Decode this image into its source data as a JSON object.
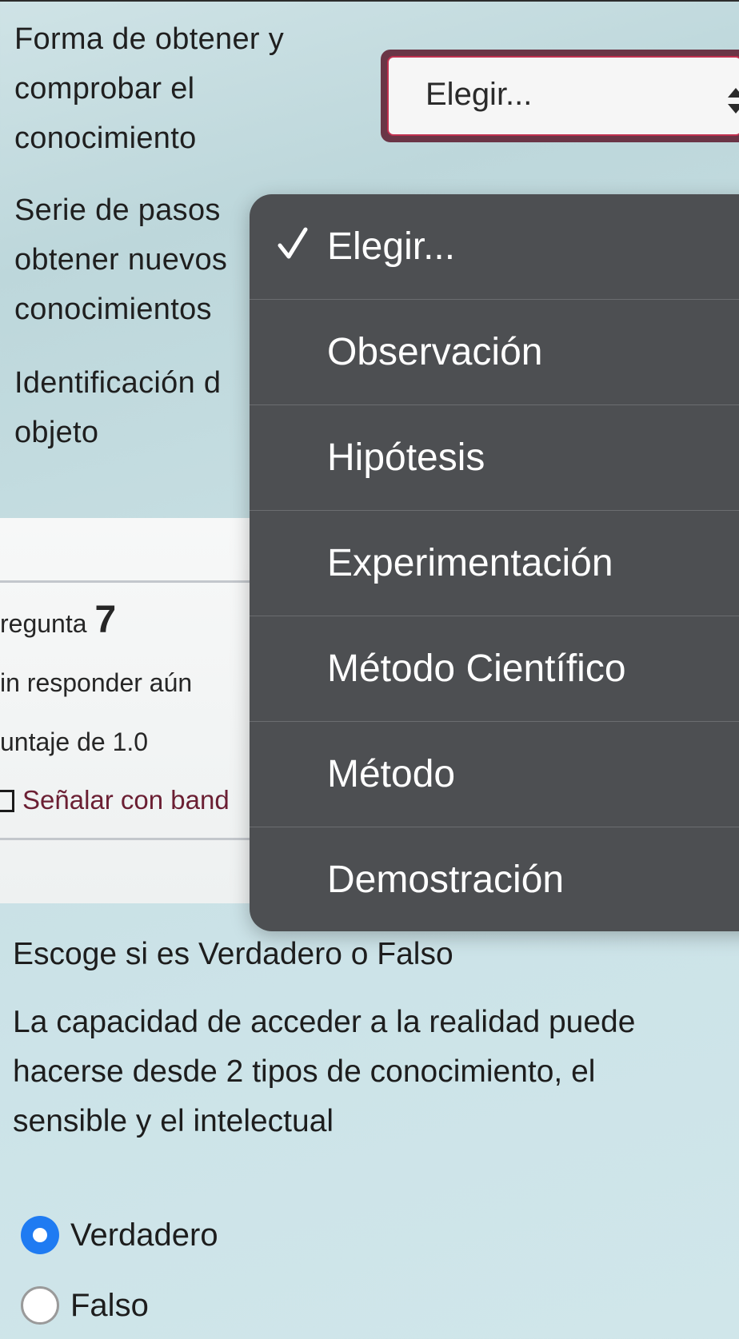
{
  "matching": {
    "rows": [
      {
        "label_lines": [
          "Forma de obtener y",
          "comprobar el",
          "conocimiento"
        ]
      },
      {
        "label_lines": [
          "Serie de pasos",
          "obtener nuevos",
          "conocimientos"
        ]
      },
      {
        "label_lines": [
          "Identificación d",
          "objeto"
        ]
      }
    ],
    "select_value": "Elegir..."
  },
  "question_info": {
    "question_word": "regunta",
    "question_number": "7",
    "status": "in responder aún",
    "score": "untaje de 1.0",
    "flag_label": "Señalar con band"
  },
  "dropdown": {
    "options": [
      {
        "label": "Elegir...",
        "selected": true
      },
      {
        "label": "Observación",
        "selected": false
      },
      {
        "label": "Hipótesis",
        "selected": false
      },
      {
        "label": "Experimentación",
        "selected": false
      },
      {
        "label": "Método Científico",
        "selected": false
      },
      {
        "label": "Método",
        "selected": false
      },
      {
        "label": "Demostración",
        "selected": false
      }
    ]
  },
  "question": {
    "instruction": "Escoge si es Verdadero o Falso",
    "text_lines": [
      "La capacidad de acceder a la realidad puede",
      "hacerse desde 2 tipos de conocimiento, el",
      "sensible y el intelectual"
    ],
    "options": [
      {
        "label": "Verdadero",
        "selected": true
      },
      {
        "label": "Falso",
        "selected": false
      }
    ]
  },
  "colors": {
    "accent_radio": "#1f7bf2",
    "menu_background": "#4d4f52",
    "select_focus_border": "#6a3546",
    "flag_text": "#6b1f33"
  }
}
